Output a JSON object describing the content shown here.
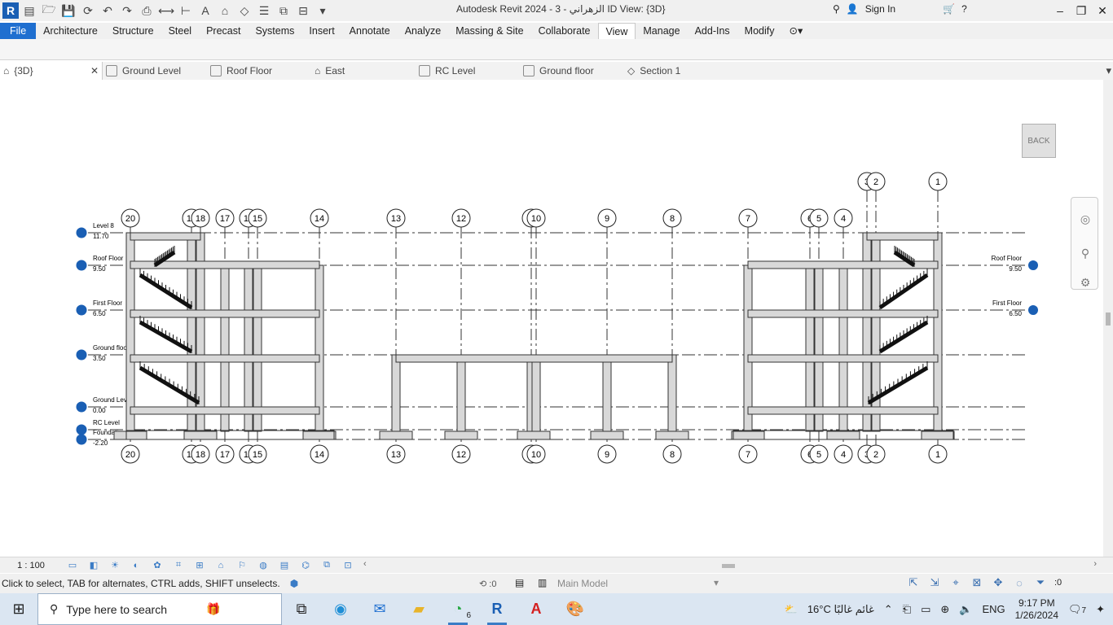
{
  "window": {
    "app_letter": "R",
    "title": "Autodesk Revit 2024 - 3 - الزهراني ID View: {3D}",
    "sign_in": "Sign In"
  },
  "ribbon": {
    "tabs": [
      "File",
      "Architecture",
      "Structure",
      "Steel",
      "Precast",
      "Systems",
      "Insert",
      "Annotate",
      "Analyze",
      "Massing & Site",
      "Collaborate",
      "View",
      "Manage",
      "Add-Ins",
      "Modify"
    ],
    "active": "View"
  },
  "view_tabs": [
    "{3D}",
    "Ground Level",
    "Roof Floor",
    "East",
    "RC Level",
    "Ground floor",
    "Section 1"
  ],
  "navigation": {
    "back_label": "BACK"
  },
  "drawing": {
    "levels_left": [
      {
        "name": "Level 8",
        "elev": "11.70"
      },
      {
        "name": "Roof Floor",
        "elev": "9.50"
      },
      {
        "name": "First Floor",
        "elev": "6.50"
      },
      {
        "name": "Ground floor",
        "elev": "3.50"
      },
      {
        "name": "Ground Level",
        "elev": "0.00"
      },
      {
        "name": "RC Level",
        "elev": ""
      },
      {
        "name": "Foundation Level",
        "elev": "-2.20"
      }
    ],
    "levels_right": [
      {
        "name": "Roof Floor",
        "elev": "9.50"
      },
      {
        "name": "First Floor",
        "elev": "6.50"
      }
    ],
    "grids": [
      "20",
      "19",
      "18",
      "17",
      "16",
      "15",
      "14",
      "13",
      "12",
      "11",
      "10",
      "9",
      "8",
      "7",
      "6",
      "5",
      "4",
      "3",
      "2",
      "1"
    ]
  },
  "view_control": {
    "scale": "1 : 100"
  },
  "status": {
    "message": "Click to select, TAB for alternates, CTRL adds, SHIFT unselects.",
    "workset": ":0",
    "model": "Main Model",
    "filter": ":0"
  },
  "taskbar": {
    "search_placeholder": "Type here to search",
    "whatsapp_badge": "6",
    "weather": "16°C  غائم غالبًا",
    "lang": "ENG",
    "time": "9:17 PM",
    "date": "1/26/2024",
    "notif_count": "7"
  }
}
